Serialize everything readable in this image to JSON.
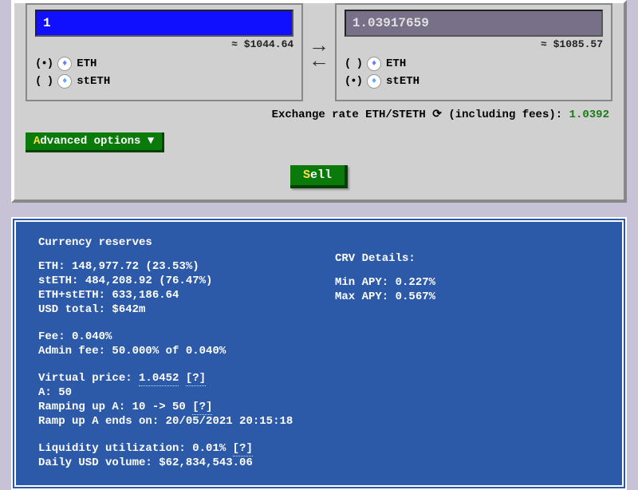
{
  "swap": {
    "from": {
      "amount": "1",
      "usd": "≈ $1044.64",
      "tokens": [
        {
          "selected": "(•)",
          "icon": "eth",
          "label": "ETH"
        },
        {
          "selected": "( )",
          "icon": "steth",
          "label": "stETH"
        }
      ]
    },
    "to": {
      "amount": "1.03917659",
      "usd": "≈ $1085.57",
      "tokens": [
        {
          "selected": "( )",
          "icon": "eth",
          "label": "ETH"
        },
        {
          "selected": "(•)",
          "icon": "steth",
          "label": "stETH"
        }
      ]
    },
    "arrows": "⇄",
    "rate_prefix": "Exchange rate ETH/STETH ",
    "rate_suffix": " (including fees): ",
    "rate_value": "1.0392",
    "refresh": "⟳"
  },
  "buttons": {
    "advanced_first": "A",
    "advanced_rest": "dvanced options ▼",
    "sell_first": "S",
    "sell_rest": "ell"
  },
  "reserves": {
    "title": "Currency reserves",
    "eth_label": "ETH: ",
    "eth_value": "148,977.72 (23.53%)",
    "steth_label": "stETH: ",
    "steth_value": "484,208.92 (76.47%)",
    "sum_label": "ETH+stETH: ",
    "sum_value": "633,186.64",
    "usd_label": "USD total: ",
    "usd_value": "$642m",
    "fee_label": "Fee: ",
    "fee_value": "0.040%",
    "admin_label": "Admin fee: ",
    "admin_value": "50.000% of 0.040%",
    "vp_label": "Virtual price: ",
    "vp_value": "1.0452",
    "help": "[?]",
    "a_label": "A: ",
    "a_value": "50",
    "ramp_label": "Ramping up A: ",
    "ramp_value": "10 -> 50 ",
    "ramp_end_label": "Ramp up A ends on: ",
    "ramp_end_value": "20/05/2021 20:15:18",
    "liq_label": "Liquidity utilization: ",
    "liq_value": "0.01% ",
    "vol_label": "Daily USD volume: ",
    "vol_value": "$62,834,543.06"
  },
  "crv": {
    "title": "CRV Details:",
    "min_label": "Min APY: ",
    "min_value": "0.227%",
    "max_label": "Max APY: ",
    "max_value": "0.567%"
  }
}
